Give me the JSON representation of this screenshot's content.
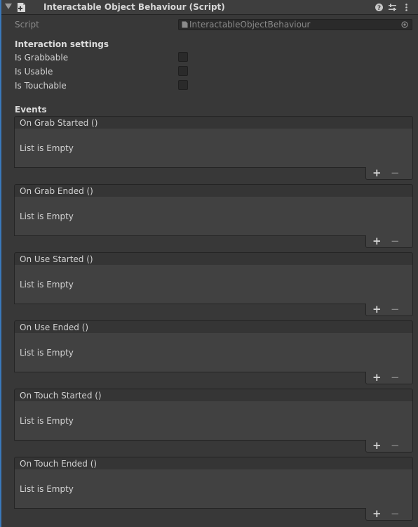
{
  "component": {
    "title": "Interactable Object Behaviour (Script)",
    "icons": [
      "foldout-arrow-icon",
      "script-icon",
      "help-icon",
      "presets-icon",
      "more-options-icon"
    ]
  },
  "script_field": {
    "label": "Script",
    "value": "InteractableObjectBehaviour"
  },
  "interaction_settings": {
    "heading": "Interaction settings",
    "fields": [
      {
        "label": "Is Grabbable",
        "checked": false
      },
      {
        "label": "Is Usable",
        "checked": false
      },
      {
        "label": "Is Touchable",
        "checked": false
      }
    ]
  },
  "events": {
    "heading": "Events",
    "items": [
      {
        "title": "On Grab Started ()",
        "empty_text": "List is Empty"
      },
      {
        "title": "On Grab Ended ()",
        "empty_text": "List is Empty"
      },
      {
        "title": "On Use Started ()",
        "empty_text": "List is Empty"
      },
      {
        "title": "On Use Ended ()",
        "empty_text": "List is Empty"
      },
      {
        "title": "On Touch Started ()",
        "empty_text": "List is Empty"
      },
      {
        "title": "On Touch Ended ()",
        "empty_text": "List is Empty"
      }
    ],
    "add_label": "+",
    "remove_label": "−"
  },
  "colors": {
    "background": "#383838",
    "accent": "#3a79bb",
    "field": "#2a2a2a"
  }
}
